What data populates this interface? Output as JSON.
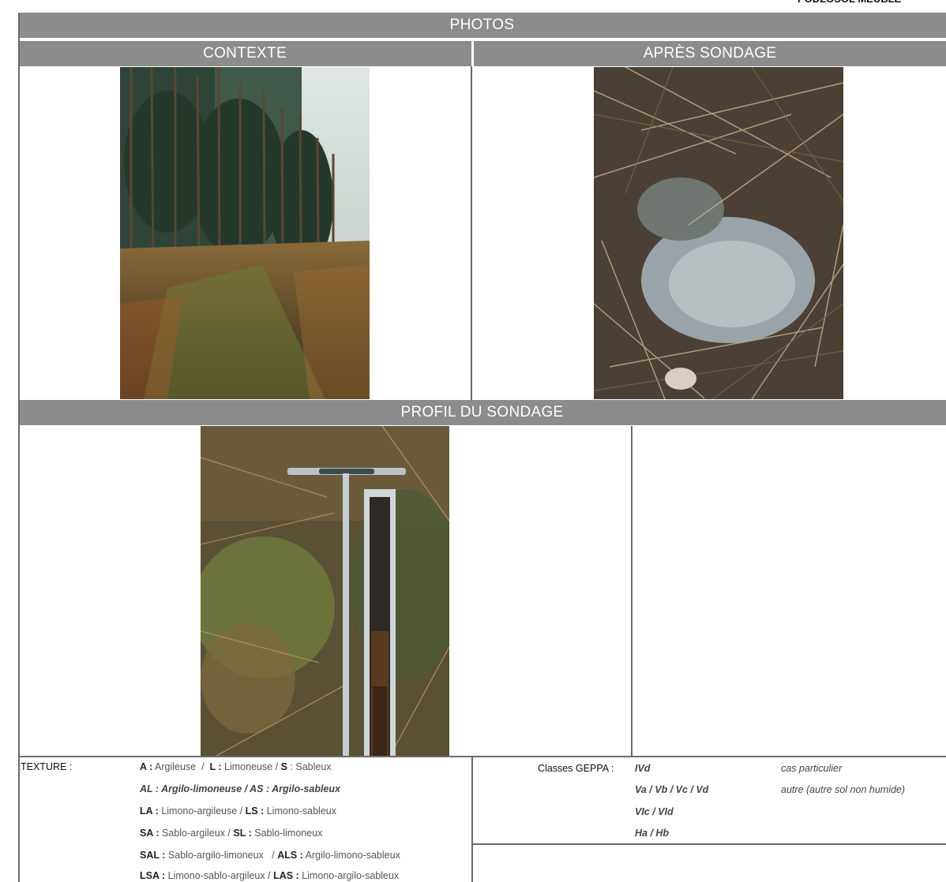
{
  "document": {
    "title": "PODZOSOL MEUBLE"
  },
  "sections": {
    "photos": "PHOTOS",
    "contexte": "CONTEXTE",
    "apres": "APRÈS SONDAGE",
    "profil": "PROFIL DU SONDAGE"
  },
  "texture": {
    "label": "TEXTURE :",
    "rows": [
      [
        {
          "code": "A :",
          "name": "Argileuse"
        },
        {
          "code": "L :",
          "name": "Limoneuse"
        },
        {
          "code": "S",
          "name": ": Sableux"
        }
      ],
      "AL : Argilo-limoneuse / AS : Argilo-sableux",
      [
        {
          "code": "LA :",
          "name": "Limono-argileuse"
        },
        {
          "code": "LS :",
          "name": "Limono-sableux"
        }
      ],
      [
        {
          "code": "SA :",
          "name": "Sablo-argileux"
        },
        {
          "code": "SL :",
          "name": "Sablo-limoneux"
        }
      ],
      [
        {
          "code": "SAL :",
          "name": "Sablo-argilo-limoneux"
        },
        {
          "code": "ALS :",
          "name": "Argilo-limono-sableux"
        }
      ],
      [
        {
          "code": "LSA :",
          "name": "Limono-sablo-argileux"
        },
        {
          "code": "LAS :",
          "name": "Limono-argilo-sableux"
        }
      ]
    ]
  },
  "geppa": {
    "label": "Classes GEPPA :",
    "classes": [
      "IVd",
      "Va / Vb / Vc / Vd",
      "VIc / VId",
      "Ha / Hb"
    ],
    "other": [
      "cas particulier",
      "autre (autre sol non humide)"
    ]
  },
  "colors": {
    "bar": "#8c8c8c",
    "lines": "#6b6b6b"
  }
}
